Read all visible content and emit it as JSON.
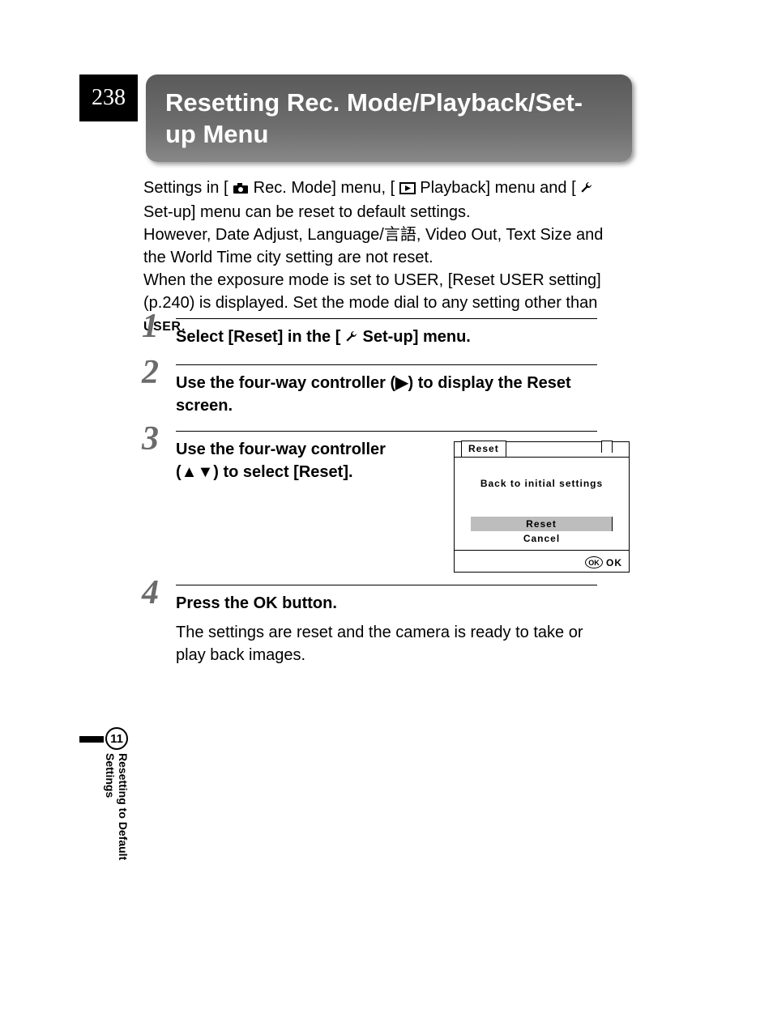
{
  "page_number": "238",
  "title": "Resetting Rec. Mode/Playback/Set-up Menu",
  "intro": {
    "part1a": "Settings in [",
    "part1b": " Rec. Mode] menu, [",
    "part1c": " Playback] menu and [",
    "part1d": " Set-up] menu can be reset to default settings.",
    "part2a": "However, Date Adjust, Language/",
    "lang_glyph": "言語",
    "part2b": ", Video Out, Text Size and the World Time city setting are not reset.",
    "part3a": "When the exposure mode is set to USER, [Reset USER setting] (p.240) is displayed. Set the mode dial to any setting other than ",
    "user_label": "USER",
    "part3b": "."
  },
  "steps": {
    "s1": {
      "num": "1",
      "text_a": "Select [Reset] in the [",
      "text_b": " Set-up] menu."
    },
    "s2": {
      "num": "2",
      "text_a": "Use the four-way controller (",
      "arrow_right": "▶",
      "text_b": ") to display the Reset screen."
    },
    "s3": {
      "num": "3",
      "text_a": "Use the four-way controller (",
      "arrow_up": "▲",
      "arrow_down": "▼",
      "text_b": ") to select [Reset]."
    },
    "s4": {
      "num": "4",
      "text_a": "Press the ",
      "ok": "OK",
      "text_b": " button.",
      "body": "The settings are reset and the camera is ready to take or play back images."
    }
  },
  "lcd": {
    "tab": "Reset",
    "message": "Back to initial settings",
    "option_reset": "Reset",
    "option_cancel": "Cancel",
    "footer_ok_inner": "OK",
    "footer_ok_label": "OK"
  },
  "side": {
    "chapter": "11",
    "label": "Resetting to Default Settings"
  }
}
